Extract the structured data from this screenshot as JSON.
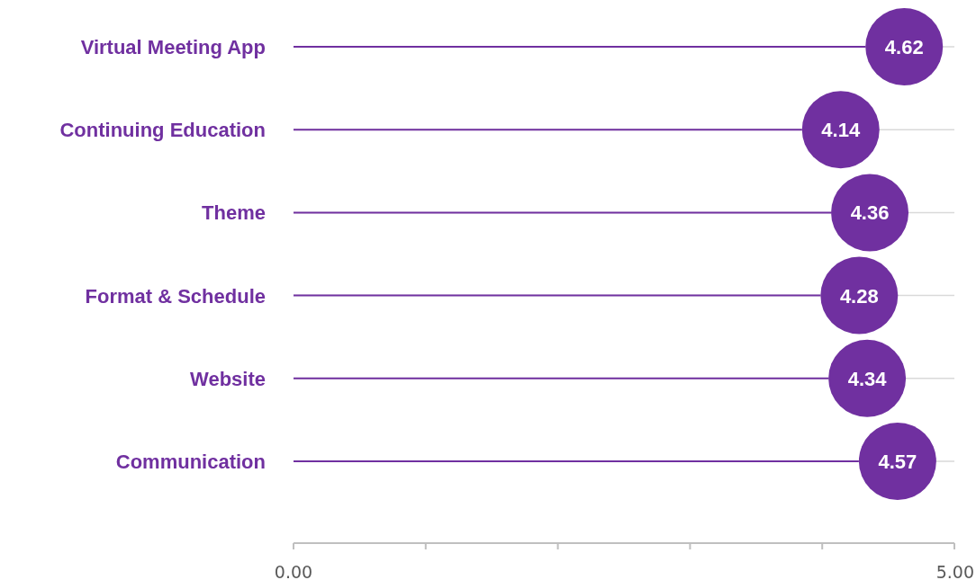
{
  "chart": {
    "chart_data": {
      "type": "scatter",
      "orientation": "horizontal",
      "categories": [
        "Virtual Meeting App",
        "Continuing Education",
        "Theme",
        "Format & Schedule",
        "Website",
        "Communication"
      ],
      "series": [
        {
          "color": "#7030a0",
          "values": [
            4.62,
            4.14,
            4.36,
            4.28,
            4.34,
            4.57
          ]
        }
      ],
      "value_labels": [
        "4.62",
        "4.14",
        "4.36",
        "4.28",
        "4.34",
        "4.57"
      ],
      "xlim": [
        0,
        5
      ],
      "xticks": [
        {
          "value": 0,
          "label": "0.00"
        },
        {
          "value": 5,
          "label": "5.00"
        }
      ],
      "data_labels": true,
      "grid": true
    }
  }
}
